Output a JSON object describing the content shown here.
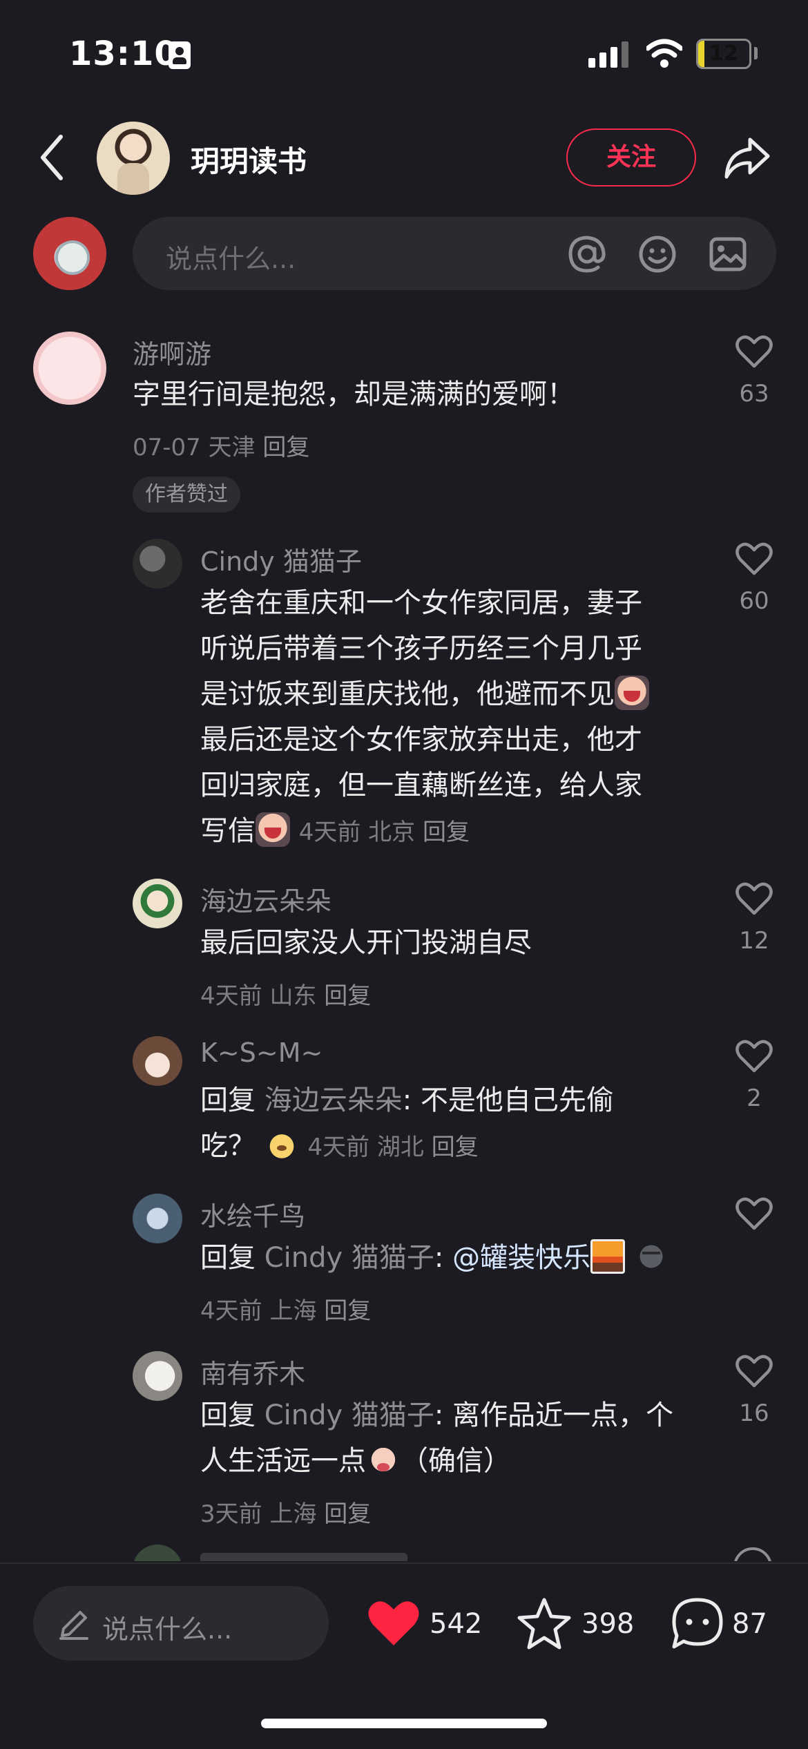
{
  "status_bar": {
    "time": "13:10",
    "battery": "12",
    "battery_level": 0.12
  },
  "header": {
    "author_name": "玥玥读书",
    "follow_label": "关注"
  },
  "comment_input": {
    "placeholder": "说点什么..."
  },
  "comments": [
    {
      "username": "游啊游",
      "text": "字里行间是抱怨，却是满满的爱啊！",
      "date": "07-07",
      "location": "天津",
      "reply_label": "回复",
      "badge": "作者赞过",
      "likes": "63"
    }
  ],
  "replies": [
    {
      "username": "Cindy 猫猫子",
      "text_lines": [
        "老舍在重庆和一个女作家同居，妻子",
        "听说后带着三个孩子历经三个月几乎",
        "是讨饭来到重庆找他，他避而不见",
        "最后还是这个女作家放弃出走，他才",
        "回归家庭，但一直藕断丝连，给人家",
        "写信"
      ],
      "emoji_1": "cry-emoji",
      "emoji_2": "cry-emoji",
      "time": "4天前",
      "location": "北京",
      "reply_label": "回复",
      "likes": "60"
    },
    {
      "username": "海边云朵朵",
      "text": "最后回家没人开门投湖自尽",
      "time": "4天前",
      "location": "山东",
      "reply_label": "回复",
      "likes": "12"
    },
    {
      "username": "K~S~M~",
      "reply_prefix": "回复",
      "reply_target": "海边云朵朵",
      "text_line1": ": 不是他自己先偷",
      "text_line2": "吃？",
      "emoji": "dog-emoji",
      "time": "4天前",
      "location": "湖北",
      "reply_label": "回复",
      "likes": "2"
    },
    {
      "username": "水绘千鸟",
      "reply_prefix": "回复",
      "reply_target": "Cindy 猫猫子",
      "separator": ":",
      "mention": "@罐装快乐",
      "emoji_1": "sunset-emoji",
      "emoji_2": "moon-emoji",
      "time": "4天前",
      "location": "上海",
      "reply_label": "回复"
    },
    {
      "username": "南有乔木",
      "reply_prefix": "回复",
      "reply_target": "Cindy 猫猫子",
      "text_line1": ": 离作品近一点，个",
      "text_line2a": "人生活远一点",
      "text_line2b": "（确信）",
      "emoji": "sob-emoji",
      "time": "3天前",
      "location": "上海",
      "reply_label": "回复",
      "likes": "16"
    }
  ],
  "bottom_bar": {
    "input_placeholder": "说点什么...",
    "likes": "542",
    "favorites": "398",
    "comments": "87",
    "like_color": "#ff2442"
  },
  "icons": [
    "back-icon",
    "share-icon",
    "at-icon",
    "emoji-icon",
    "image-icon",
    "heart-icon",
    "star-icon",
    "chat-icon",
    "pencil-icon"
  ]
}
